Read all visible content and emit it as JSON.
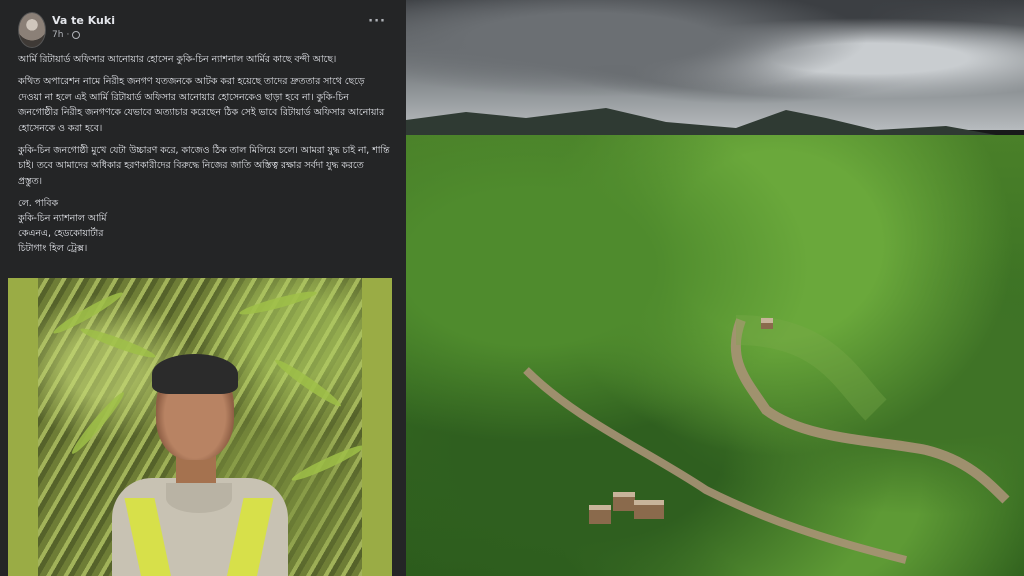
{
  "post": {
    "author": "Va te Kuki",
    "time": "7h",
    "more_icon": "more-horizontal-icon",
    "privacy_icon": "globe-icon",
    "paragraphs": [
      "আর্মি রিটায়ার্ড অফিসার আনোয়ার হোসেন কুকি-চিন ন্যাশনাল আর্মির কাছে বন্দী আছে।",
      "কথিত অপারেশন নামে নিরীহ জনগণ যতজনকে আটক করা হয়েছে তাদের দ্রুততার সাথে ছেড়ে দেওয়া না হলে এই আর্মি রিটায়ার্ড অফিসার আনোয়ার হোসেনকেও ছাড়া হবে না। কুকি-চিন জনগোষ্ঠীর নিরীহ জনগণকে যেভাবে অত্যাচার করেছেন ঠিক সেই ভাবে রিটায়ার্ড অফিসার আনোয়ার হোসেনকে ও করা হবে।",
      "কুকি-চিন জনগোষ্ঠী মুখে যেটা উচ্চারণ করে, কাজেও ঠিক তাল মিলিয়ে চলে। আমরা যুদ্ধ চাই না, শান্তি চাই। তবে আমাদের অধিকার হরণকারীদের বিরুদ্ধে নিজের জাতি অস্তিত্ব রক্ষার সর্বদা যুদ্ধ করতে প্রস্তুত।"
    ],
    "signature": [
      "লে. পাবিক",
      "কুকি-চিন ন্যাশনাল আর্মি",
      "কেএনএ, হেডকোয়ার্টার",
      "চিটাগাং হিল ট্রেক্স।"
    ]
  },
  "colors": {
    "card_bg": "#242526",
    "text": "#e4e6eb",
    "photo_border": "#9aac45"
  }
}
